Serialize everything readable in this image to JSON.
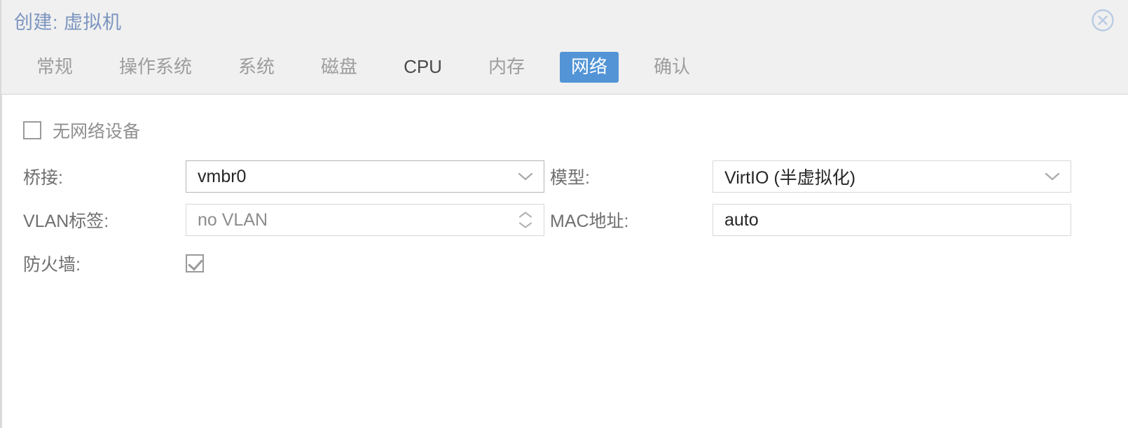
{
  "dialog": {
    "title": "创建: 虚拟机",
    "close_icon": "close-circle-icon"
  },
  "tabs": [
    {
      "label": "常规",
      "active": false
    },
    {
      "label": "操作系统",
      "active": false
    },
    {
      "label": "系统",
      "active": false
    },
    {
      "label": "磁盘",
      "active": false
    },
    {
      "label": "CPU",
      "active": false
    },
    {
      "label": "内存",
      "active": false
    },
    {
      "label": "网络",
      "active": true
    },
    {
      "label": "确认",
      "active": false
    }
  ],
  "form": {
    "no_network_device": {
      "label": "无网络设备",
      "checked": false
    },
    "bridge": {
      "label": "桥接:",
      "value": "vmbr0",
      "icon": "chevron-down-icon"
    },
    "model": {
      "label": "模型:",
      "value": "VirtIO (半虚拟化)",
      "icon": "chevron-down-icon"
    },
    "vlan_tag": {
      "label": "VLAN标签:",
      "value": "no VLAN",
      "is_placeholder": true,
      "icon": "spinner-updown-icon"
    },
    "mac_address": {
      "label": "MAC地址:",
      "value": "auto"
    },
    "firewall": {
      "label": "防火墙:",
      "checked": true
    }
  },
  "colors": {
    "accent": "#5294d6",
    "title": "#7b95bf",
    "header_bg": "#f0f0f0",
    "body_bg": "#ffffff",
    "label": "#6f6f6f",
    "value": "#262626",
    "placeholder": "#8d8d8d",
    "tab_inactive": "#9d9d9d",
    "border": "#d8d8d8"
  }
}
